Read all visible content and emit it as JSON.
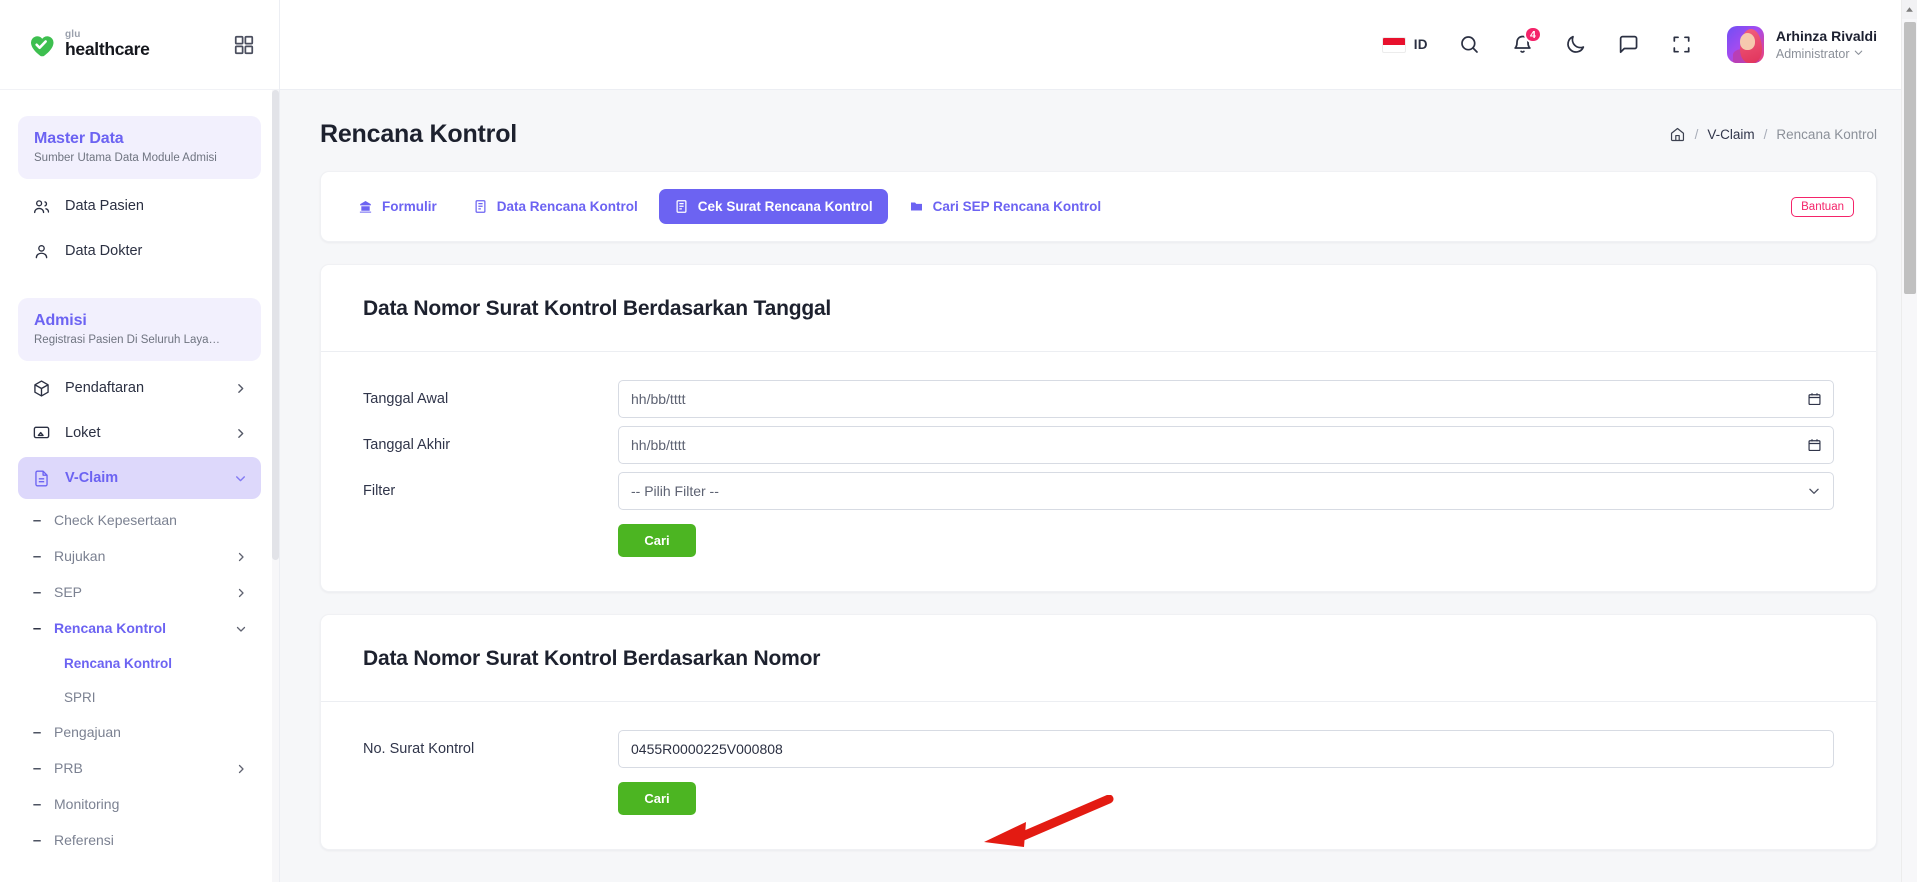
{
  "brand": {
    "sub": "glu",
    "name": "healthcare",
    "grid_icon": "grid-apps-icon"
  },
  "sidebar": {
    "groups": [
      {
        "title": "Master Data",
        "subtitle": "Sumber Utama Data Module Admisi"
      },
      {
        "title": "Admisi",
        "subtitle": "Registrasi Pasien Di Seluruh Laya…"
      }
    ],
    "items": [
      {
        "label": "Data Pasien",
        "icon": "users-icon",
        "chevron": false,
        "active": false
      },
      {
        "label": "Data Dokter",
        "icon": "user-icon",
        "chevron": false,
        "active": false
      },
      {
        "label": "Pendaftaran",
        "icon": "box-icon",
        "chevron": true,
        "active": false
      },
      {
        "label": "Loket",
        "icon": "monitor-icon",
        "chevron": true,
        "active": false
      },
      {
        "label": "V-Claim",
        "icon": "document-icon",
        "chevron": true,
        "active": true
      }
    ],
    "subitems": [
      {
        "label": "Check Kepesertaan",
        "chevron": false,
        "current": false
      },
      {
        "label": "Rujukan",
        "chevron": true,
        "current": false
      },
      {
        "label": "SEP",
        "chevron": true,
        "current": false
      },
      {
        "label": "Rencana Kontrol",
        "chevron": true,
        "current": true
      },
      {
        "label": "Pengajuan",
        "chevron": false,
        "current": false
      },
      {
        "label": "PRB",
        "chevron": true,
        "current": false
      },
      {
        "label": "Monitoring",
        "chevron": false,
        "current": false
      },
      {
        "label": "Referensi",
        "chevron": false,
        "current": false
      }
    ],
    "subsub": [
      {
        "label": "Rencana Kontrol",
        "current": true
      },
      {
        "label": "SPRI",
        "current": false
      }
    ]
  },
  "topbar": {
    "language_code": "ID",
    "language_flag": "indonesia-flag-icon",
    "search_icon": "search-icon",
    "notification_icon": "bell-icon",
    "notification_count": "4",
    "theme_icon": "moon-icon",
    "chat_icon": "message-icon",
    "fullscreen_icon": "fullscreen-icon",
    "user_name": "Arhinza Rivaldi",
    "user_role": "Administrator"
  },
  "page": {
    "title": "Rencana Kontrol",
    "breadcrumb": {
      "home_icon": "home-icon",
      "parent": "V-Claim",
      "current": "Rencana Kontrol",
      "separator": "/"
    }
  },
  "tabs": [
    {
      "label": "Formulir",
      "icon": "form-icon",
      "active": false
    },
    {
      "label": "Data Rencana Kontrol",
      "icon": "list-icon",
      "active": false
    },
    {
      "label": "Cek Surat Rencana Kontrol",
      "icon": "check-doc-icon",
      "active": true
    },
    {
      "label": "Cari SEP Rencana Kontrol",
      "icon": "folder-icon",
      "active": false
    }
  ],
  "help_button": "Bantuan",
  "section_by_date": {
    "title": "Data Nomor Surat Kontrol Berdasarkan Tanggal",
    "fields": [
      {
        "label": "Tanggal Awal",
        "value": "",
        "placeholder": "hh/bb/tttt",
        "type": "date",
        "icon": "calendar-icon"
      },
      {
        "label": "Tanggal Akhir",
        "value": "",
        "placeholder": "hh/bb/tttt",
        "type": "date",
        "icon": "calendar-icon"
      },
      {
        "label": "Filter",
        "value": "-- Pilih Filter --",
        "placeholder": "-- Pilih Filter --",
        "type": "select",
        "icon": "chevron-down-icon"
      }
    ],
    "submit_label": "Cari"
  },
  "section_by_number": {
    "title": "Data Nomor Surat Kontrol Berdasarkan Nomor",
    "fields": [
      {
        "label": "No. Surat Kontrol",
        "value": "0455R0000225V000808",
        "placeholder": "",
        "type": "text",
        "icon": ""
      }
    ],
    "submit_label": "Cari"
  },
  "colors": {
    "brand_purple": "#6c63f2",
    "brand_purple_soft": "#ddd8fb",
    "group_bg": "#f2f0fd",
    "green": "#4cb522",
    "pink": "#f4246a",
    "annotation_red": "#e31b12",
    "page_bg": "#f6f7f9"
  },
  "annotation": {
    "shape": "arrow-pointer",
    "color": "#e31b12",
    "points_to": "Cari"
  }
}
